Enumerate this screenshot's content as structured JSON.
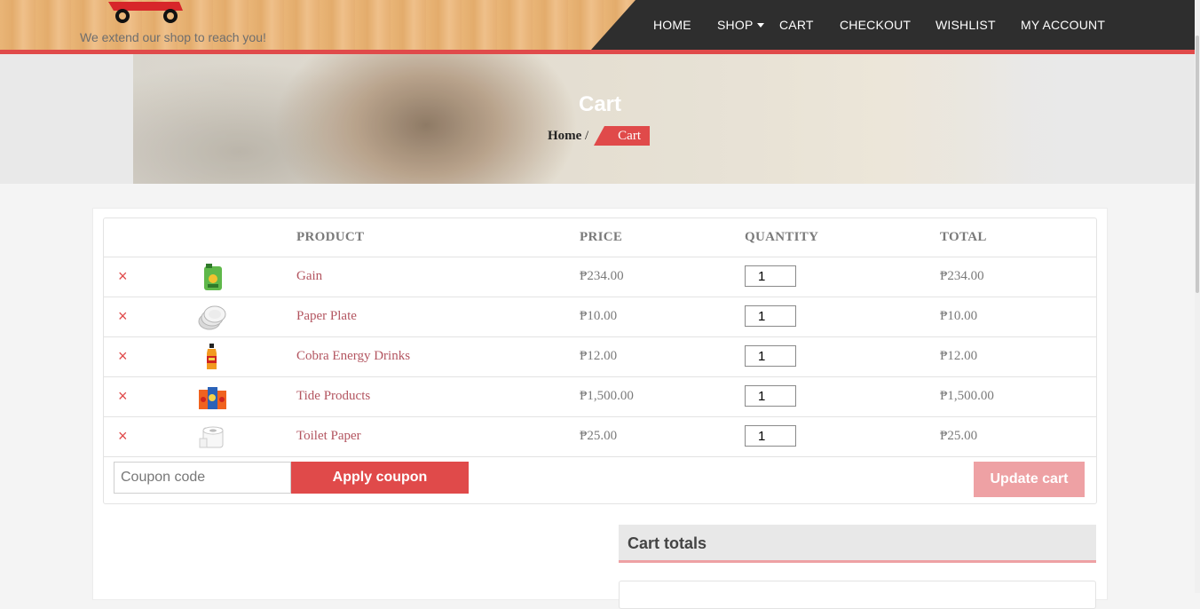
{
  "header": {
    "tagline": "We extend our shop to reach you!",
    "nav": [
      "HOME",
      "SHOP",
      "CART",
      "CHECKOUT",
      "WISHLIST",
      "MY ACCOUNT"
    ]
  },
  "banner": {
    "title": "Cart",
    "breadcrumb_home": "Home",
    "breadcrumb_sep": "/",
    "breadcrumb_current": "Cart"
  },
  "cart": {
    "headers": {
      "product": "PRODUCT",
      "price": "PRICE",
      "quantity": "QUANTITY",
      "total": "TOTAL"
    },
    "remove_symbol": "×",
    "items": [
      {
        "name": "Gain",
        "price": "₱234.00",
        "qty": "1",
        "total": "₱234.00",
        "thumb": "gain-bottle-icon"
      },
      {
        "name": "Paper Plate",
        "price": "₱10.00",
        "qty": "1",
        "total": "₱10.00",
        "thumb": "paper-plate-icon"
      },
      {
        "name": "Cobra Energy Drinks",
        "price": "₱12.00",
        "qty": "1",
        "total": "₱12.00",
        "thumb": "energy-drink-icon"
      },
      {
        "name": "Tide Products",
        "price": "₱1,500.00",
        "qty": "1",
        "total": "₱1,500.00",
        "thumb": "tide-products-icon"
      },
      {
        "name": "Toilet Paper",
        "price": "₱25.00",
        "qty": "1",
        "total": "₱25.00",
        "thumb": "toilet-paper-icon"
      }
    ],
    "coupon_placeholder": "Coupon code",
    "apply_label": "Apply coupon",
    "update_label": "Update cart"
  },
  "totals": {
    "title": "Cart totals"
  },
  "colors": {
    "accent": "#e04a4a",
    "nav_bg": "#2e2e2e",
    "link": "#b35560"
  }
}
